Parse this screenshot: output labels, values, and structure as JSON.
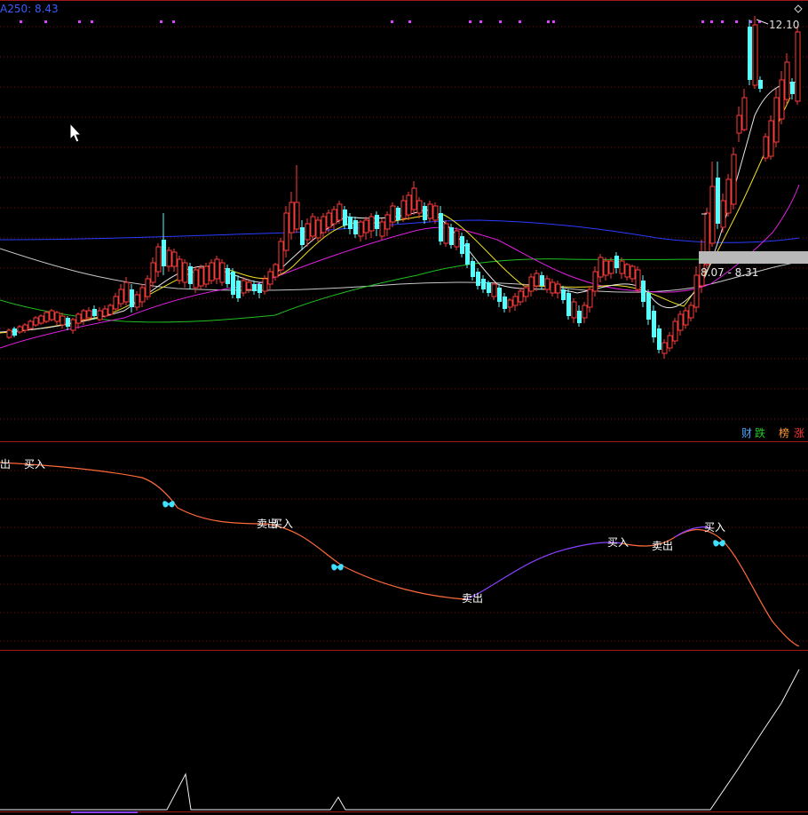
{
  "indicator_readout": {
    "text": "A250: 8.43",
    "color": "#3b5bff"
  },
  "price_axis": {
    "high_label": "12.10",
    "low_box_label": "8.07 - 8.31"
  },
  "corner_icon": "diamond-icon",
  "badges": [
    {
      "text": "财",
      "color": "#4da6ff"
    },
    {
      "text": "跌",
      "color": "#22cc22"
    },
    {
      "text": "榜",
      "color": "#ff9933"
    },
    {
      "text": "涨",
      "color": "#ff3333"
    }
  ],
  "signals": [
    {
      "id": "sig-1",
      "text": "出"
    },
    {
      "id": "sig-2",
      "text": "买入"
    },
    {
      "id": "sig-3",
      "text": "卖出"
    },
    {
      "id": "sig-4",
      "text": "买入"
    },
    {
      "id": "sig-5",
      "text": "卖出"
    },
    {
      "id": "sig-6",
      "text": "买入"
    },
    {
      "id": "sig-7",
      "text": "卖出"
    },
    {
      "id": "sig-8",
      "text": "买入"
    }
  ],
  "colors": {
    "up": "#ff3b3b",
    "down": "#54ffff",
    "grid": "#7a1010",
    "panel_border": "#a01818",
    "ma_white": "#e8e8e8",
    "ma_yellow": "#f0e020",
    "ma_magenta": "#e020e0",
    "ma_green": "#20c020",
    "ma_blue": "#2b3bff",
    "ma_longwhite": "#c8c8c8",
    "butterfly": "#40e0ff",
    "dots": "#e040ff"
  },
  "icons": [
    "mouse-cursor-icon",
    "butterfly-icon"
  ]
}
